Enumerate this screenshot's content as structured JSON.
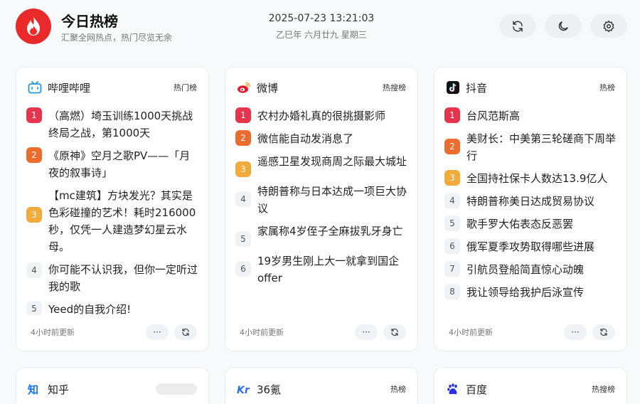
{
  "app": {
    "title": "今日热榜",
    "subtitle": "汇聚全网热点，热门尽览无余",
    "datetime": "2025-07-23 13:21:03",
    "lunar": "乙巳年 六月廿九 星期三",
    "brand_color": "#ea2a2a"
  },
  "cards": [
    {
      "source": "哔哩哔哩",
      "badge": "热门榜",
      "updated": "4小时前更新",
      "more": "···",
      "items": [
        {
          "rank": "1",
          "title": "（高燃）埼玉训练1000天挑战终局之战，第1000天"
        },
        {
          "rank": "2",
          "title": "《原神》空月之歌PV——「月夜的叙事诗」"
        },
        {
          "rank": "3",
          "title": "【mc建筑】方块发光？其实是色彩碰撞的艺术！耗时216000秒，仅凭一人建造梦幻星云水母。"
        },
        {
          "rank": "4",
          "title": "你可能不认识我，但你一定听过我的歌"
        },
        {
          "rank": "5",
          "title": "Yeed的自我介绍!"
        }
      ]
    },
    {
      "source": "微博",
      "badge": "热搜榜",
      "updated": "4小时前更新",
      "more": "···",
      "items": [
        {
          "rank": "1",
          "title": "农村办婚礼真的很挑摄影师"
        },
        {
          "rank": "2",
          "title": "微信能自动发消息了"
        },
        {
          "rank": "3",
          "title": "遥感卫星发现商周之际最大城址"
        },
        {
          "rank": "4",
          "title": "特朗普称与日本达成一项巨大协议"
        },
        {
          "rank": "5",
          "title": "家属称4岁侄子全麻拔乳牙身亡"
        },
        {
          "rank": "6",
          "title": "19岁男生刚上大一就拿到国企offer"
        }
      ]
    },
    {
      "source": "抖音",
      "badge": "热榜",
      "updated": "4小时前更新",
      "more": "···",
      "items": [
        {
          "rank": "1",
          "title": "台风范斯高"
        },
        {
          "rank": "2",
          "title": "美财长：中美第三轮磋商下周举行"
        },
        {
          "rank": "3",
          "title": "全国持社保卡人数达13.9亿人"
        },
        {
          "rank": "4",
          "title": "特朗普称美日达成贸易协议"
        },
        {
          "rank": "5",
          "title": "歌手罗大佑表态反恶罢"
        },
        {
          "rank": "6",
          "title": "俄军夏季攻势取得哪些进展"
        },
        {
          "rank": "7",
          "title": "引航员登船简直惊心动魄"
        },
        {
          "rank": "8",
          "title": "我让领导给我护后泳宣传"
        }
      ]
    }
  ],
  "bottom_cards": [
    {
      "source": "知乎",
      "badge": ""
    },
    {
      "source": "36氪",
      "badge": "热榜"
    },
    {
      "source": "百度",
      "badge": "热搜榜"
    }
  ]
}
